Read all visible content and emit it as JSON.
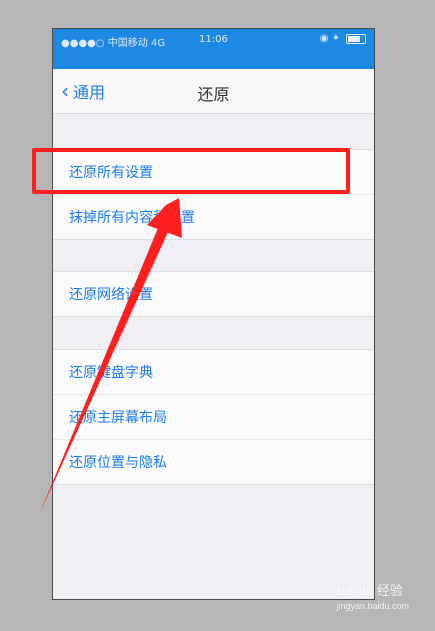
{
  "statusbar": {
    "carrier": "●●●●○ 中国移动 4G",
    "time": "11:06",
    "battery": "battery-icon",
    "indicators": "◉ ✦"
  },
  "nav": {
    "back_label": "通用",
    "title": "还原"
  },
  "groups": [
    {
      "items": [
        "还原所有设置",
        "抹掉所有内容和设置"
      ]
    },
    {
      "items": [
        "还原网络设置"
      ]
    },
    {
      "items": [
        "还原键盘字典",
        "还原主屏幕布局",
        "还原位置与隐私"
      ]
    }
  ],
  "watermark": {
    "text": "Bai du 经验",
    "sub": "jingyan.baidu.com"
  },
  "colors": {
    "accent": "#1d7cf2",
    "highlight": "#ff1f1f",
    "statusbar": "#1e88e5"
  }
}
